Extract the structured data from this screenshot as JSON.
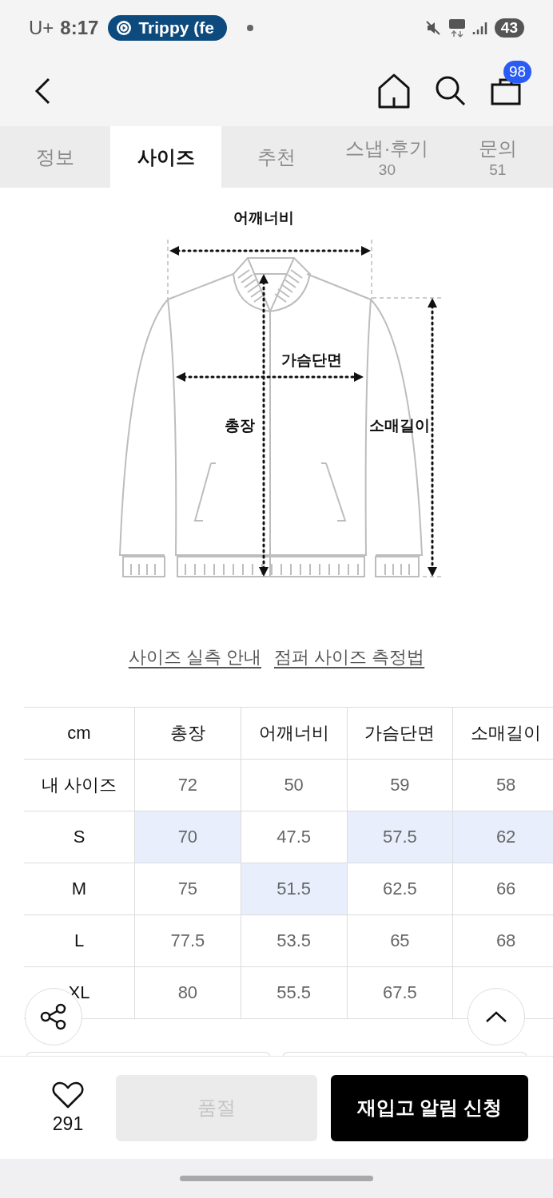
{
  "status_bar": {
    "carrier": "U+",
    "time": "8:17",
    "notification": "Trippy (fe",
    "battery": "43"
  },
  "header": {
    "cart_count": "98"
  },
  "tabs": [
    {
      "label": "정보",
      "selected": false
    },
    {
      "label": "사이즈",
      "selected": true
    },
    {
      "label": "추천",
      "selected": false
    },
    {
      "label": "스냅·후기",
      "count": "30",
      "selected": false
    },
    {
      "label": "문의",
      "count": "51",
      "selected": false
    }
  ],
  "diagram": {
    "labels": [
      "어깨너비",
      "가슴단면",
      "총장",
      "소매길이"
    ]
  },
  "links": [
    "사이즈 실측 안내",
    "점퍼 사이즈 측정법"
  ],
  "size_table": {
    "columns": [
      "cm",
      "총장",
      "어깨너비",
      "가슴단면",
      "소매길이"
    ],
    "rows": [
      {
        "cells": [
          {
            "text": "내 사이즈",
            "highlighted": false
          },
          {
            "text": "72",
            "highlighted": false
          },
          {
            "text": "50",
            "highlighted": false
          },
          {
            "text": "59",
            "highlighted": false
          },
          {
            "text": "58",
            "highlighted": false
          }
        ]
      },
      {
        "cells": [
          {
            "text": "S",
            "highlighted": false
          },
          {
            "text": "70",
            "highlighted": true
          },
          {
            "text": "47.5",
            "highlighted": false
          },
          {
            "text": "57.5",
            "highlighted": true
          },
          {
            "text": "62",
            "highlighted": true
          }
        ]
      },
      {
        "cells": [
          {
            "text": "M",
            "highlighted": false
          },
          {
            "text": "75",
            "highlighted": false
          },
          {
            "text": "51.5",
            "highlighted": true
          },
          {
            "text": "62.5",
            "highlighted": false
          },
          {
            "text": "66",
            "highlighted": false
          }
        ]
      },
      {
        "cells": [
          {
            "text": "L",
            "highlighted": false
          },
          {
            "text": "77.5",
            "highlighted": false
          },
          {
            "text": "53.5",
            "highlighted": false
          },
          {
            "text": "65",
            "highlighted": false
          },
          {
            "text": "68",
            "highlighted": false
          }
        ]
      },
      {
        "cells": [
          {
            "text": "XL",
            "highlighted": false
          },
          {
            "text": "80",
            "highlighted": false
          },
          {
            "text": "55.5",
            "highlighted": false
          },
          {
            "text": "67.5",
            "highlighted": false
          }
        ]
      }
    ]
  },
  "action_bar": {
    "likes": "291",
    "buttons": [
      {
        "label": "품절",
        "disabled": true
      },
      {
        "label": "재입고 알림 신청",
        "disabled": false
      }
    ]
  }
}
